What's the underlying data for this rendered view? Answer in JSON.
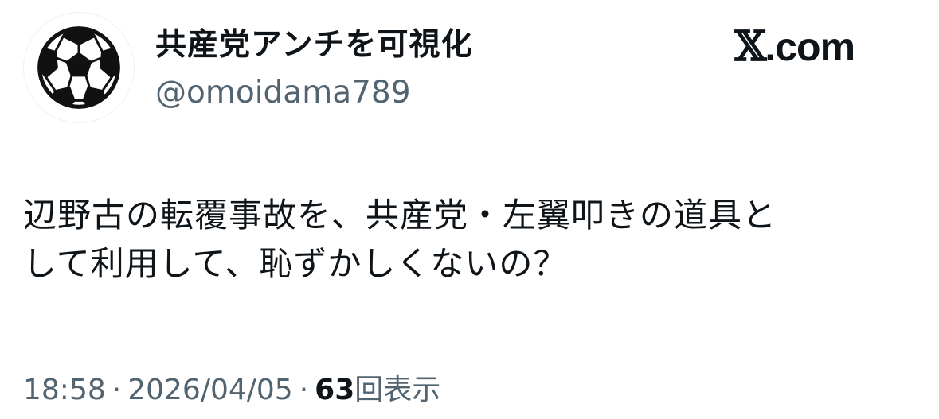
{
  "author": {
    "display_name": "共産党アンチを可視化",
    "handle": "@omoidama789",
    "avatar_icon": "soccer-ball-icon"
  },
  "brand": {
    "icon": "x-logo-icon",
    "text": ".com"
  },
  "tweet": {
    "lines": [
      "辺野古の転覆事故を、共産党・左翼叩きの道具と",
      "して利用して、恥ずかしくないの？"
    ]
  },
  "meta": {
    "time": "18:58",
    "separator": "·",
    "date": "2026/04/05",
    "views_count": "63",
    "views_label": "回表示"
  },
  "colors": {
    "text_primary": "#0f1419",
    "text_secondary": "#536471",
    "background": "#ffffff"
  }
}
